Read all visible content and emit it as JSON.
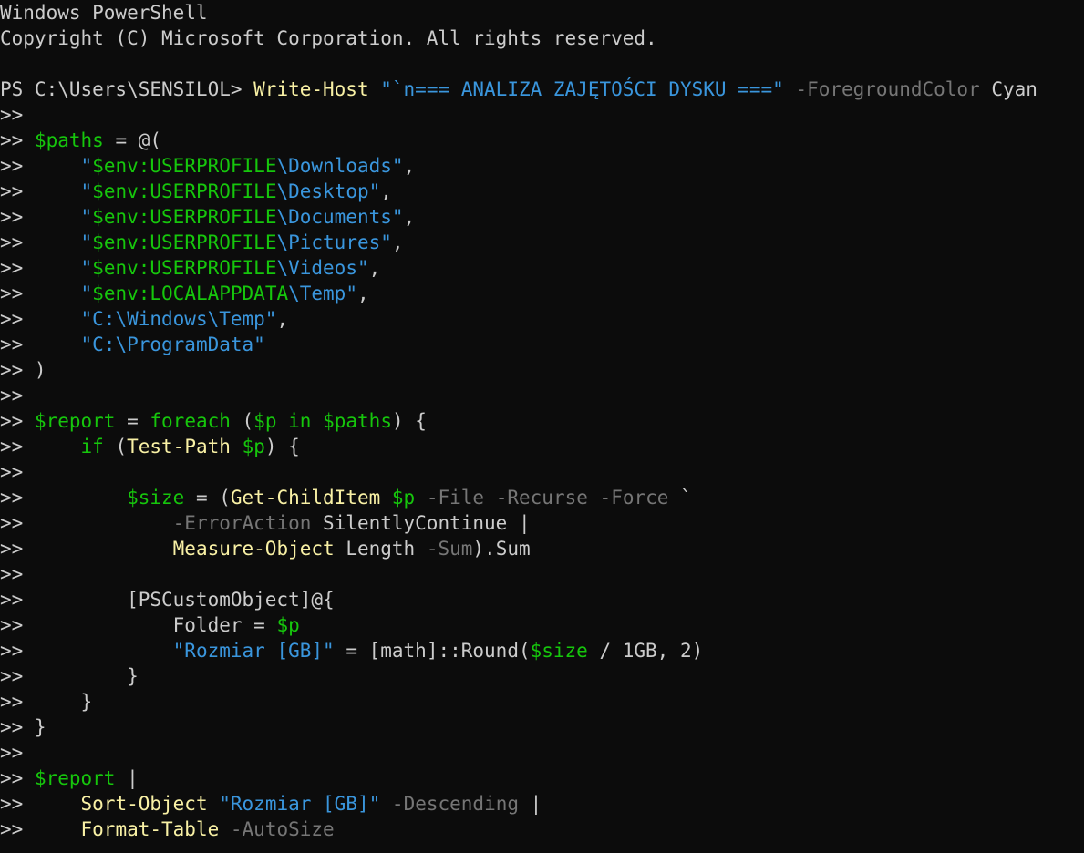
{
  "window": {
    "title": "Windows PowerShell"
  },
  "colors": {
    "background": "#0c0c0c",
    "default": "#cccccc",
    "command": "#f9f1a5",
    "string": "#3a96dd",
    "variable": "#16c60c",
    "parameter": "#767676",
    "keyword": "#16c60c"
  },
  "lines": [
    [
      {
        "text": "Windows PowerShell",
        "style": "default"
      }
    ],
    [
      {
        "text": "Copyright (C) Microsoft Corporation. All rights reserved.",
        "style": "default"
      }
    ],
    [],
    [
      {
        "text": "PS C:\\Users\\SENSILOL> ",
        "style": "default"
      },
      {
        "text": "Write-Host",
        "style": "command"
      },
      {
        "text": " ",
        "style": "default"
      },
      {
        "text": "\"`n=== ANALIZA ZAJĘTOŚCI DYSKU ===\"",
        "style": "string"
      },
      {
        "text": " ",
        "style": "default"
      },
      {
        "text": "-ForegroundColor",
        "style": "parameter"
      },
      {
        "text": " Cyan",
        "style": "default"
      }
    ],
    [
      {
        "text": ">>",
        "style": "default"
      }
    ],
    [
      {
        "text": ">> ",
        "style": "default"
      },
      {
        "text": "$paths",
        "style": "variable"
      },
      {
        "text": " = @(",
        "style": "default"
      }
    ],
    [
      {
        "text": ">>     ",
        "style": "default"
      },
      {
        "text": "\"",
        "style": "string"
      },
      {
        "text": "$env:USERPROFILE",
        "style": "variable"
      },
      {
        "text": "\\Downloads\"",
        "style": "string"
      },
      {
        "text": ",",
        "style": "default"
      }
    ],
    [
      {
        "text": ">>     ",
        "style": "default"
      },
      {
        "text": "\"",
        "style": "string"
      },
      {
        "text": "$env:USERPROFILE",
        "style": "variable"
      },
      {
        "text": "\\Desktop\"",
        "style": "string"
      },
      {
        "text": ",",
        "style": "default"
      }
    ],
    [
      {
        "text": ">>     ",
        "style": "default"
      },
      {
        "text": "\"",
        "style": "string"
      },
      {
        "text": "$env:USERPROFILE",
        "style": "variable"
      },
      {
        "text": "\\Documents\"",
        "style": "string"
      },
      {
        "text": ",",
        "style": "default"
      }
    ],
    [
      {
        "text": ">>     ",
        "style": "default"
      },
      {
        "text": "\"",
        "style": "string"
      },
      {
        "text": "$env:USERPROFILE",
        "style": "variable"
      },
      {
        "text": "\\Pictures\"",
        "style": "string"
      },
      {
        "text": ",",
        "style": "default"
      }
    ],
    [
      {
        "text": ">>     ",
        "style": "default"
      },
      {
        "text": "\"",
        "style": "string"
      },
      {
        "text": "$env:USERPROFILE",
        "style": "variable"
      },
      {
        "text": "\\Videos\"",
        "style": "string"
      },
      {
        "text": ",",
        "style": "default"
      }
    ],
    [
      {
        "text": ">>     ",
        "style": "default"
      },
      {
        "text": "\"",
        "style": "string"
      },
      {
        "text": "$env:LOCALAPPDATA",
        "style": "variable"
      },
      {
        "text": "\\Temp\"",
        "style": "string"
      },
      {
        "text": ",",
        "style": "default"
      }
    ],
    [
      {
        "text": ">>     ",
        "style": "default"
      },
      {
        "text": "\"C:\\Windows\\Temp\"",
        "style": "string"
      },
      {
        "text": ",",
        "style": "default"
      }
    ],
    [
      {
        "text": ">>     ",
        "style": "default"
      },
      {
        "text": "\"C:\\ProgramData\"",
        "style": "string"
      }
    ],
    [
      {
        "text": ">> )",
        "style": "default"
      }
    ],
    [
      {
        "text": ">>",
        "style": "default"
      }
    ],
    [
      {
        "text": ">> ",
        "style": "default"
      },
      {
        "text": "$report",
        "style": "variable"
      },
      {
        "text": " = ",
        "style": "default"
      },
      {
        "text": "foreach",
        "style": "keyword"
      },
      {
        "text": " (",
        "style": "default"
      },
      {
        "text": "$p",
        "style": "variable"
      },
      {
        "text": " ",
        "style": "default"
      },
      {
        "text": "in",
        "style": "keyword"
      },
      {
        "text": " ",
        "style": "default"
      },
      {
        "text": "$paths",
        "style": "variable"
      },
      {
        "text": ") {",
        "style": "default"
      }
    ],
    [
      {
        "text": ">>     ",
        "style": "default"
      },
      {
        "text": "if",
        "style": "keyword"
      },
      {
        "text": " (",
        "style": "default"
      },
      {
        "text": "Test-Path",
        "style": "command"
      },
      {
        "text": " ",
        "style": "default"
      },
      {
        "text": "$p",
        "style": "variable"
      },
      {
        "text": ") {",
        "style": "default"
      }
    ],
    [
      {
        "text": ">>",
        "style": "default"
      }
    ],
    [
      {
        "text": ">>         ",
        "style": "default"
      },
      {
        "text": "$size",
        "style": "variable"
      },
      {
        "text": " = (",
        "style": "default"
      },
      {
        "text": "Get-ChildItem",
        "style": "command"
      },
      {
        "text": " ",
        "style": "default"
      },
      {
        "text": "$p",
        "style": "variable"
      },
      {
        "text": " ",
        "style": "default"
      },
      {
        "text": "-File",
        "style": "parameter"
      },
      {
        "text": " ",
        "style": "default"
      },
      {
        "text": "-Recurse",
        "style": "parameter"
      },
      {
        "text": " ",
        "style": "default"
      },
      {
        "text": "-Force",
        "style": "parameter"
      },
      {
        "text": " `",
        "style": "default"
      }
    ],
    [
      {
        "text": ">>             ",
        "style": "default"
      },
      {
        "text": "-ErrorAction",
        "style": "parameter"
      },
      {
        "text": " SilentlyContinue |",
        "style": "default"
      }
    ],
    [
      {
        "text": ">>             ",
        "style": "default"
      },
      {
        "text": "Measure-Object",
        "style": "command"
      },
      {
        "text": " Length ",
        "style": "default"
      },
      {
        "text": "-Sum",
        "style": "parameter"
      },
      {
        "text": ").Sum",
        "style": "default"
      }
    ],
    [
      {
        "text": ">>",
        "style": "default"
      }
    ],
    [
      {
        "text": ">>         [PSCustomObject]@{",
        "style": "default"
      }
    ],
    [
      {
        "text": ">>             Folder = ",
        "style": "default"
      },
      {
        "text": "$p",
        "style": "variable"
      }
    ],
    [
      {
        "text": ">>             ",
        "style": "default"
      },
      {
        "text": "\"Rozmiar [GB]\"",
        "style": "string"
      },
      {
        "text": " = [math]::Round(",
        "style": "default"
      },
      {
        "text": "$size",
        "style": "variable"
      },
      {
        "text": " / 1GB, 2)",
        "style": "default"
      }
    ],
    [
      {
        "text": ">>         }",
        "style": "default"
      }
    ],
    [
      {
        "text": ">>     }",
        "style": "default"
      }
    ],
    [
      {
        "text": ">> }",
        "style": "default"
      }
    ],
    [
      {
        "text": ">>",
        "style": "default"
      }
    ],
    [
      {
        "text": ">> ",
        "style": "default"
      },
      {
        "text": "$report",
        "style": "variable"
      },
      {
        "text": " |",
        "style": "default"
      }
    ],
    [
      {
        "text": ">>     ",
        "style": "default"
      },
      {
        "text": "Sort-Object",
        "style": "command"
      },
      {
        "text": " ",
        "style": "default"
      },
      {
        "text": "\"Rozmiar [GB]\"",
        "style": "string"
      },
      {
        "text": " ",
        "style": "default"
      },
      {
        "text": "-Descending",
        "style": "parameter"
      },
      {
        "text": " |",
        "style": "default"
      }
    ],
    [
      {
        "text": ">>     ",
        "style": "default"
      },
      {
        "text": "Format-Table",
        "style": "command"
      },
      {
        "text": " ",
        "style": "default"
      },
      {
        "text": "-AutoSize",
        "style": "parameter"
      }
    ]
  ]
}
